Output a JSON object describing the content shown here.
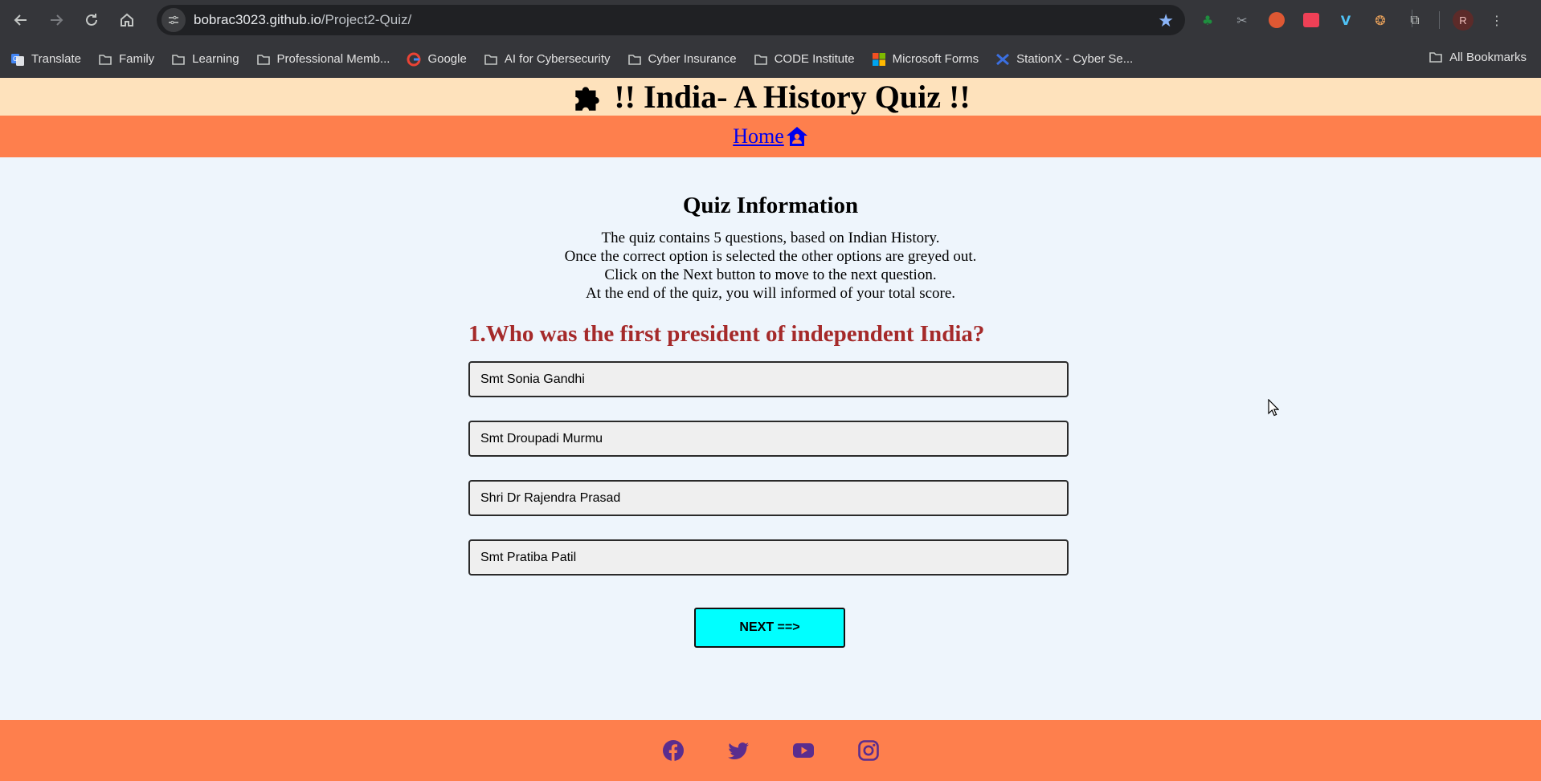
{
  "browser": {
    "url_host": "bobrac3023.github.io",
    "url_path": "/Project2-Quiz/",
    "profile_initial": "R",
    "bookmarks": [
      {
        "label": "Translate",
        "icon": "translate-icon"
      },
      {
        "label": "Family",
        "icon": "folder-icon"
      },
      {
        "label": "Learning",
        "icon": "folder-icon"
      },
      {
        "label": "Professional Memb...",
        "icon": "folder-icon"
      },
      {
        "label": "Google",
        "icon": "google-icon"
      },
      {
        "label": "AI for Cybersecurity",
        "icon": "folder-icon"
      },
      {
        "label": "Cyber Insurance",
        "icon": "folder-icon"
      },
      {
        "label": "CODE Institute",
        "icon": "folder-icon"
      },
      {
        "label": "Microsoft Forms",
        "icon": "microsoft-icon"
      },
      {
        "label": "StationX - Cyber Se...",
        "icon": "stationx-icon"
      }
    ],
    "all_bookmarks": "All Bookmarks"
  },
  "header": {
    "title": "!! India- A History Quiz !!"
  },
  "nav": {
    "home": "Home"
  },
  "info": {
    "title": "Quiz Information",
    "lines": [
      "The quiz contains 5 questions, based on Indian History.",
      "Once the correct option is selected the other options are greyed out.",
      "Click on the Next button to move to the next question.",
      "At the end of the quiz, you will informed of your total score."
    ]
  },
  "quiz": {
    "question": "1.Who was the first president of independent India?",
    "options": [
      "Smt Sonia Gandhi",
      "Smt Droupadi Murmu",
      "Shri Dr Rajendra Prasad",
      "Smt Pratiba Patil"
    ],
    "next_label": "NEXT ==>"
  },
  "footer": {
    "social": [
      "facebook-icon",
      "twitter-icon",
      "youtube-icon",
      "instagram-icon"
    ],
    "icon_color": "#5b2d8e"
  },
  "colors": {
    "header_bg": "#fee2bc",
    "nav_bg": "#fe7f4d",
    "page_bg": "#eef5fc",
    "question_color": "#a52a2a",
    "next_bg": "#00ffff"
  }
}
